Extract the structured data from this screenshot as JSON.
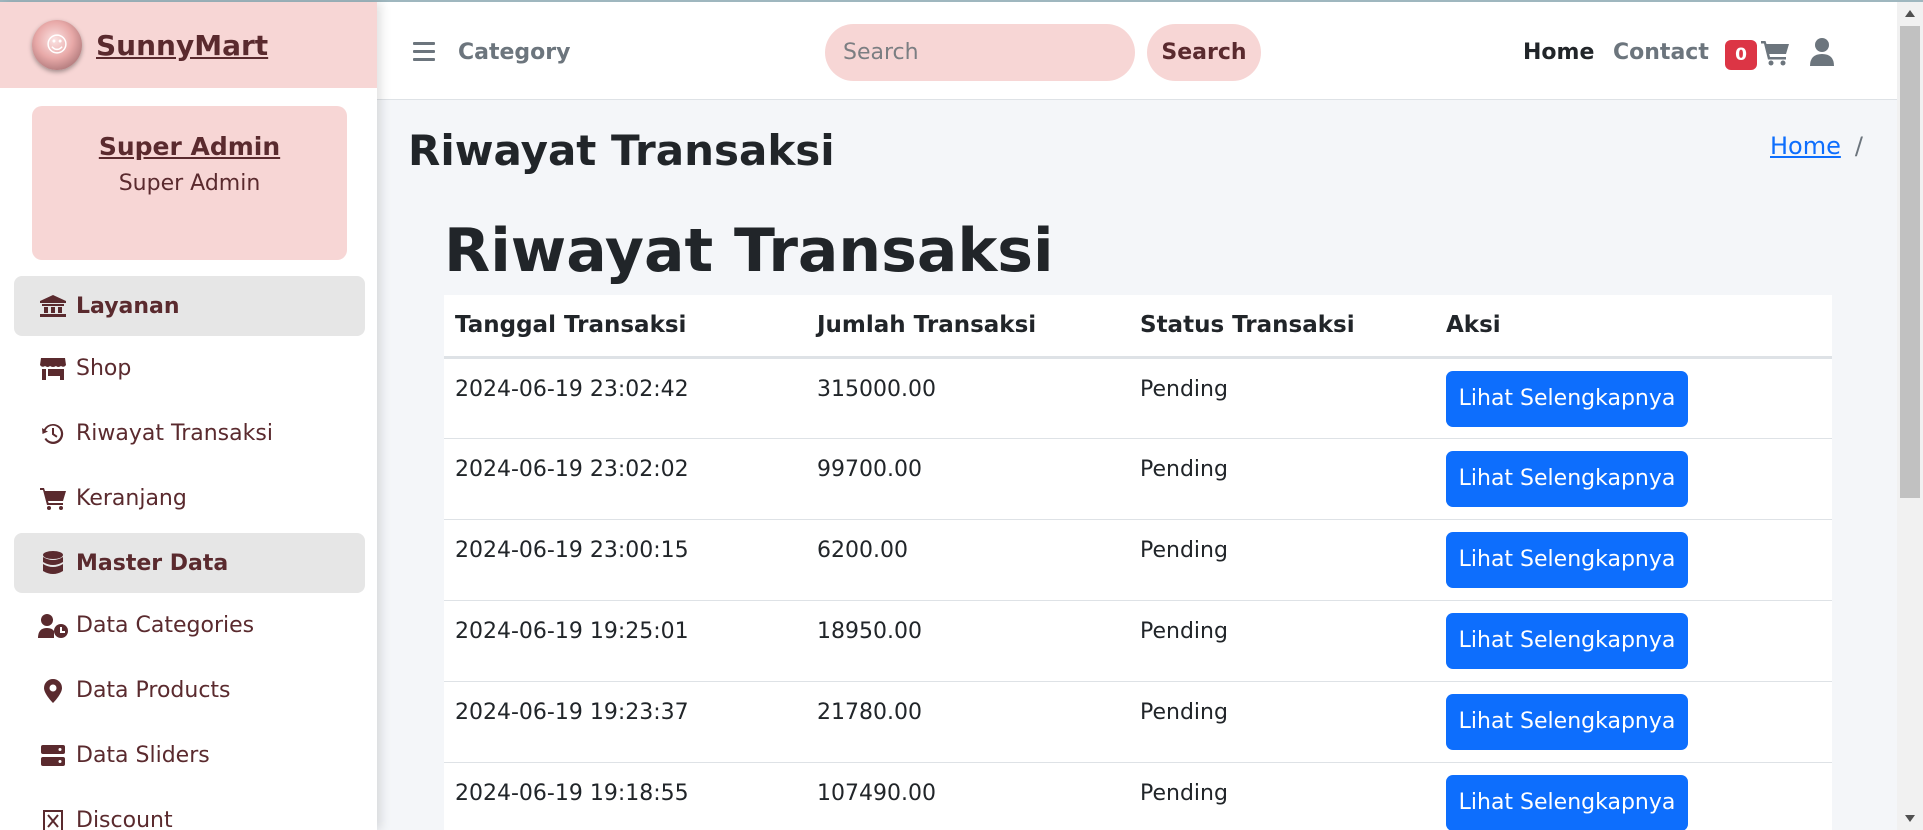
{
  "brand": {
    "name": "SunnyMart"
  },
  "user": {
    "name": "Super Admin",
    "role": "Super Admin"
  },
  "sidebar": {
    "sections": [
      {
        "header": "Layanan",
        "items": [
          "Shop",
          "Riwayat Transaksi",
          "Keranjang"
        ]
      },
      {
        "header": "Master Data",
        "items": [
          "Data Categories",
          "Data Products",
          "Data Sliders",
          "Discount"
        ]
      }
    ]
  },
  "header": {
    "category_label": "Category",
    "search_placeholder": "Search",
    "search_button": "Search",
    "nav_home": "Home",
    "nav_contact": "Contact",
    "cart_count": "0"
  },
  "page": {
    "title": "Riwayat Transaksi",
    "breadcrumb_home": "Home",
    "breadcrumb_sep": "/"
  },
  "table": {
    "title": "Riwayat Transaksi",
    "columns": [
      "Tanggal Transaksi",
      "Jumlah Transaksi",
      "Status Transaksi",
      "Aksi"
    ],
    "rows": [
      {
        "date": "2024-06-19 23:02:42",
        "amount": "315000.00",
        "status": "Pending",
        "action": "Lihat Selengkapnya"
      },
      {
        "date": "2024-06-19 23:02:02",
        "amount": "99700.00",
        "status": "Pending",
        "action": "Lihat Selengkapnya"
      },
      {
        "date": "2024-06-19 23:00:15",
        "amount": "6200.00",
        "status": "Pending",
        "action": "Lihat Selengkapnya"
      },
      {
        "date": "2024-06-19 19:25:01",
        "amount": "18950.00",
        "status": "Pending",
        "action": "Lihat Selengkapnya"
      },
      {
        "date": "2024-06-19 19:23:37",
        "amount": "21780.00",
        "status": "Pending",
        "action": "Lihat Selengkapnya"
      },
      {
        "date": "2024-06-19 19:18:55",
        "amount": "107490.00",
        "status": "Pending",
        "action": "Lihat Selengkapnya"
      }
    ]
  },
  "colors": {
    "brand_pink": "#f7d6d5",
    "brand_text": "#5a2a2e",
    "primary": "#0d6efd",
    "badge": "#dc3545"
  },
  "icons": {
    "sidebar": [
      "landmark-icon",
      "store-icon",
      "history-icon",
      "cart-icon",
      "database-icon",
      "user-clock-icon",
      "map-pin-icon",
      "server-icon",
      "square-x-icon"
    ],
    "header": [
      "hamburger-icon",
      "shopping-cart-icon",
      "user-icon"
    ]
  }
}
